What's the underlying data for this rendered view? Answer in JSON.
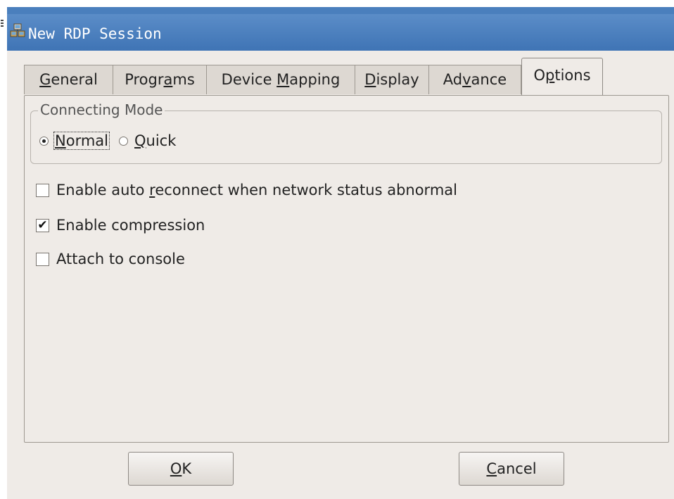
{
  "window": {
    "title": "New RDP Session",
    "icon": "network-computers-icon"
  },
  "tabs": [
    {
      "pre": "",
      "mnemonic": "G",
      "post": "eneral"
    },
    {
      "pre": "Progr",
      "mnemonic": "a",
      "post": "ms"
    },
    {
      "pre": "Device ",
      "mnemonic": "M",
      "post": "apping"
    },
    {
      "pre": "",
      "mnemonic": "D",
      "post": "isplay"
    },
    {
      "pre": "Ad",
      "mnemonic": "v",
      "post": "ance"
    },
    {
      "pre": "O",
      "mnemonic": "p",
      "post": "tions"
    }
  ],
  "active_tab": "Options",
  "connecting_mode": {
    "title": "Connecting Mode",
    "normal": {
      "pre": "",
      "mnemonic": "N",
      "post": "ormal"
    },
    "quick": {
      "pre": "",
      "mnemonic": "Q",
      "post": "uick"
    },
    "selected": "Normal"
  },
  "options": {
    "auto_reconnect": {
      "pre": "Enable auto ",
      "mnemonic": "r",
      "post": "econnect when network status abnormal",
      "checked": false
    },
    "compression": {
      "label": "Enable compression",
      "checked": true
    },
    "console": {
      "label": "Attach to console",
      "checked": false
    }
  },
  "buttons": {
    "ok": {
      "mnemonic": "O",
      "post": "K"
    },
    "cancel": {
      "mnemonic": "C",
      "post": "ancel"
    }
  },
  "colors": {
    "titlebar": "#4a7fbd",
    "dialog_bg": "#efebe7",
    "tab_inactive": "#ddd8d2"
  }
}
